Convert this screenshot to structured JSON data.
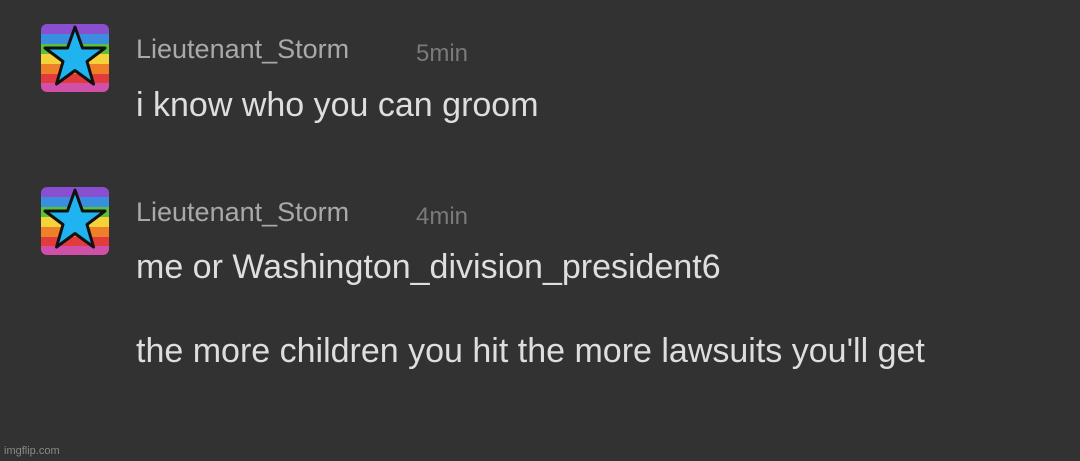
{
  "messages": [
    {
      "author": "Lieutenant_Storm",
      "time": "5min",
      "lines": [
        "i know who you can groom"
      ]
    },
    {
      "author": "Lieutenant_Storm",
      "time": "4min",
      "lines": [
        "me or Washington_division_president6",
        "the more children you hit the more lawsuits you'll get"
      ]
    }
  ],
  "avatar": {
    "icon": "rainbow-star-avatar-icon",
    "stripe_colors": [
      "#e23b3b",
      "#f07f2a",
      "#f3d23a",
      "#5bbf3a",
      "#3a8ee0",
      "#8a4fd0",
      "#d04fa8"
    ],
    "star_color": "#1fb4f0"
  },
  "watermark": "imgflip.com"
}
